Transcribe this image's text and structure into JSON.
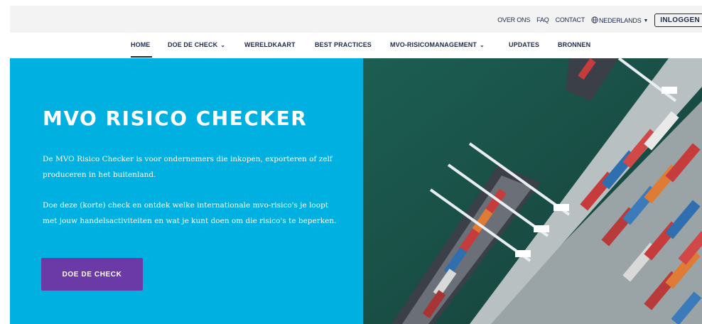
{
  "utility": {
    "links": [
      "OVER ONS",
      "FAQ",
      "CONTACT"
    ],
    "language": "NEDERLANDS",
    "login": "INLOGGEN"
  },
  "nav": {
    "items": [
      "HOME",
      "DOE DE CHECK",
      "WERELDKAART",
      "BEST PRACTICES",
      "MVO-RISICOMANAGEMENT",
      "UPDATES",
      "BRONNEN"
    ],
    "active": "HOME",
    "dropdowns": [
      "DOE DE CHECK",
      "MVO-RISICOMANAGEMENT"
    ]
  },
  "hero": {
    "title": "MVO RISICO CHECKER",
    "paragraph1": "De MVO Risico Checker is voor ondernemers die inkopen, exporteren of zelf produceren in het buitenland.",
    "paragraph2": "Doe deze (korte) check en ontdek welke internationale mvo-risico's je loopt met jouw handelsactiviteiten en wat je kunt doen om die risico's te beperken.",
    "cta": "DOE DE CHECK"
  },
  "colors": {
    "navy": "#1f2b4d",
    "hero_blue": "#00b0e0",
    "cta_purple": "#6b3aa7",
    "topbar_gray": "#f3f3f3"
  },
  "icons": {
    "language": "globe-icon",
    "dropdown": "chevron-down-icon"
  },
  "image": {
    "subject": "aerial-container-port"
  }
}
